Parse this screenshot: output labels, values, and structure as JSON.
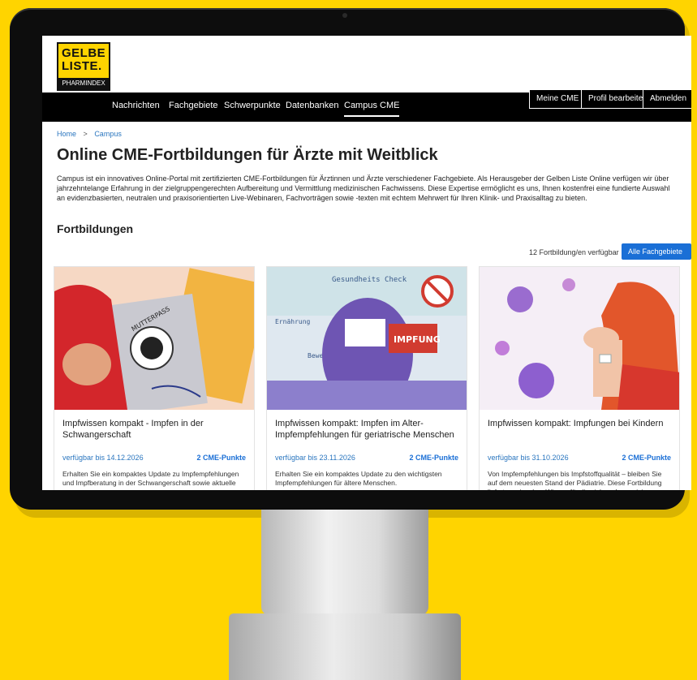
{
  "site": {
    "logo_line1": "GELBE",
    "logo_line2": "LISTE.",
    "logo_sub": "PHARMINDEX",
    "nav": [
      "Nachrichten",
      "Fachgebiete",
      "Schwerpunkte",
      "Datenbanken",
      "Campus CME"
    ],
    "buttons": {
      "meine_cme": "Meine CME",
      "profil": "Profil bearbeiten",
      "abmelden": "Abmelden"
    }
  },
  "breadcrumb": {
    "home": "Home",
    "sep": ">",
    "current": "Campus"
  },
  "page_title": "Online CME-Fortbildungen für Ärzte mit Weitblick",
  "intro": "Campus ist ein innovatives Online-Portal mit zertifizierten CME-Fortbildungen für Ärztinnen und Ärzte verschiedener Fachgebiete. Als Herausgeber der Gelben Liste Online verfügen wir über jahrzehntelange Erfahrung in der zielgruppengerechten Aufbereitung und Vermittlung medizinischen Fachwissens. Diese Expertise ermöglicht es uns, Ihnen kostenfrei eine fundierte Auswahl an evidenzbasierten, neutralen und praxisorientierten Live-Webinaren, Fachvorträgen sowie -texten mit echtem Mehrwert für Ihren Klinik- und Praxisalltag zu bieten.",
  "section_title": "Fortbildungen",
  "count_text": "12 Fortbildung/en verfügbar",
  "filter_label": "Alle Fachgebiete ▾",
  "cards": [
    {
      "title": "Impfwissen kompakt - Impfen in der Schwangerschaft",
      "available": "verfügbar bis 14.12.2026",
      "points": "2 CME-Punkte",
      "desc": "Erhalten Sie ein kompaktes Update zu Impfempfehlungen und Impfberatung in der Schwangerschaft sowie aktuelle",
      "image_labels": [
        "MUTTERPASS"
      ]
    },
    {
      "title": "Impfwissen kompakt: Impfen im Alter- Impfempfehlungen für geriatrische Menschen",
      "available": "verfügbar bis 23.11.2026",
      "points": "2 CME-Punkte",
      "desc": "Erhalten Sie ein kompaktes Update zu den wichtigsten Impfempfehlungen für ältere Menschen.",
      "image_labels": [
        "Gesundheits Check",
        "Ernährung",
        "Bewegung",
        "IMPFUNG"
      ]
    },
    {
      "title": "Impfwissen kompakt: Impfungen bei Kindern",
      "available": "verfügbar bis 31.10.2026",
      "points": "2 CME-Punkte",
      "desc": "Von Impfempfehlungen bis Impfstoffqualität – bleiben Sie auf dem neuesten Stand der Pädiatrie. Diese Fortbildung liefert praxisnahes Wissen für die sichere Immunisierung Ihrer jungen Patient:innen.",
      "image_labels": []
    }
  ]
}
